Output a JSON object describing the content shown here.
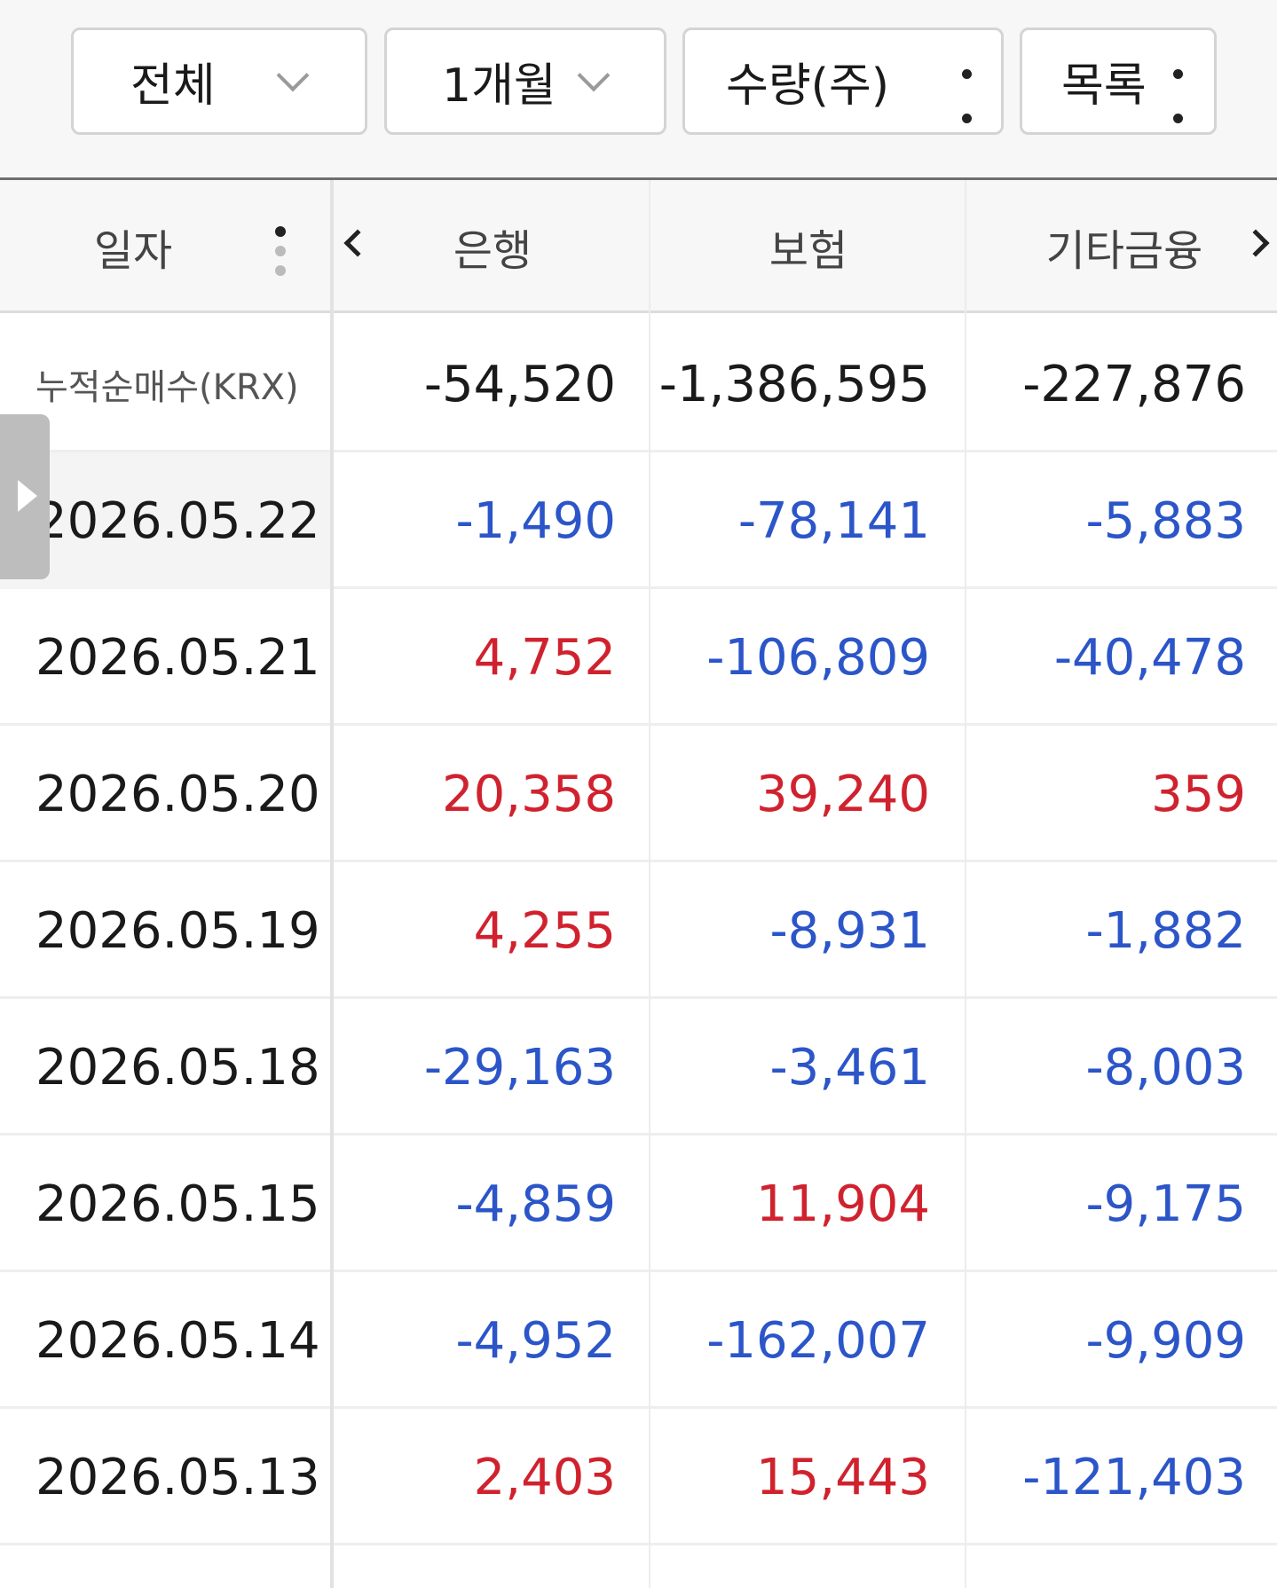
{
  "filters": {
    "scope": "전체",
    "period": "1개월",
    "unit": "수량(주)",
    "view": "목록"
  },
  "table": {
    "headers": {
      "date": "일자",
      "col1": "은행",
      "col2": "보험",
      "col3": "기타금융"
    },
    "cumulative": {
      "label": "누적순매수(KRX)",
      "values": [
        "-54,520",
        "-1,386,595",
        "-227,876"
      ]
    },
    "rows": [
      {
        "date": "2026.05.22",
        "values": [
          "-1,490",
          "-78,141",
          "-5,883"
        ],
        "signs": [
          "neg",
          "neg",
          "neg"
        ]
      },
      {
        "date": "2026.05.21",
        "values": [
          "4,752",
          "-106,809",
          "-40,478"
        ],
        "signs": [
          "pos",
          "neg",
          "neg"
        ]
      },
      {
        "date": "2026.05.20",
        "values": [
          "20,358",
          "39,240",
          "359"
        ],
        "signs": [
          "pos",
          "pos",
          "pos"
        ]
      },
      {
        "date": "2026.05.19",
        "values": [
          "4,255",
          "-8,931",
          "-1,882"
        ],
        "signs": [
          "pos",
          "neg",
          "neg"
        ]
      },
      {
        "date": "2026.05.18",
        "values": [
          "-29,163",
          "-3,461",
          "-8,003"
        ],
        "signs": [
          "neg",
          "neg",
          "neg"
        ]
      },
      {
        "date": "2026.05.15",
        "values": [
          "-4,859",
          "11,904",
          "-9,175"
        ],
        "signs": [
          "neg",
          "pos",
          "neg"
        ]
      },
      {
        "date": "2026.05.14",
        "values": [
          "-4,952",
          "-162,007",
          "-9,909"
        ],
        "signs": [
          "neg",
          "neg",
          "neg"
        ]
      },
      {
        "date": "2026.05.13",
        "values": [
          "2,403",
          "15,443",
          "-121,403"
        ],
        "signs": [
          "pos",
          "pos",
          "neg"
        ]
      }
    ]
  },
  "colors": {
    "positive": "#d0222e",
    "negative": "#2b55c8",
    "neutral": "#1a1a1a"
  },
  "icons": {
    "dropdown": "chevron-down-icon",
    "menu": "kebab-menu-icon",
    "prev": "chevron-left-icon",
    "next": "chevron-right-icon",
    "panel": "triangle-right-icon"
  }
}
